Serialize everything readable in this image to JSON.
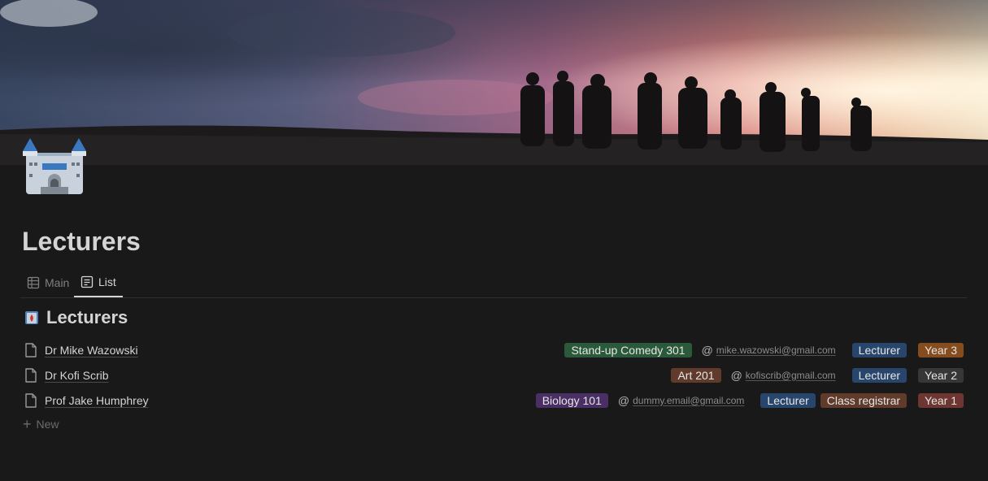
{
  "page": {
    "title": "Lecturers",
    "icon": "castle-icon",
    "cover": "sunset-silhouettes-cover"
  },
  "tabs": [
    {
      "label": "Main",
      "icon": "table-icon",
      "active": false
    },
    {
      "label": "List",
      "icon": "list-icon",
      "active": true
    }
  ],
  "database": {
    "title": "Lecturers",
    "icon": "castle-icon"
  },
  "rows": [
    {
      "name": "Dr Mike Wazowski",
      "course": "Stand-up Comedy 301",
      "course_color": "#2b5a3a",
      "email": "mike.wazowski@gmail.com",
      "roles": [
        {
          "label": "Lecturer",
          "color": "#28456c"
        }
      ],
      "year": "Year 3",
      "year_color": "#854c1d"
    },
    {
      "name": "Dr Kofi Scrib",
      "course": "Art 201",
      "course_color": "#603b2c",
      "email": "kofiscrib@gmail.com",
      "roles": [
        {
          "label": "Lecturer",
          "color": "#28456c"
        }
      ],
      "year": "Year 2",
      "year_color": "#373737"
    },
    {
      "name": "Prof Jake Humphrey",
      "course": "Biology 101",
      "course_color": "#492f64",
      "email": "dummy.email@gmail.com",
      "roles": [
        {
          "label": "Lecturer",
          "color": "#28456c"
        },
        {
          "label": "Class registrar",
          "color": "#603b2c"
        }
      ],
      "year": "Year 1",
      "year_color": "#6e3630"
    }
  ],
  "new_label": "New",
  "colors": {
    "background": "#191919",
    "text": "#d4d4d4",
    "muted": "#7f7f7f"
  }
}
